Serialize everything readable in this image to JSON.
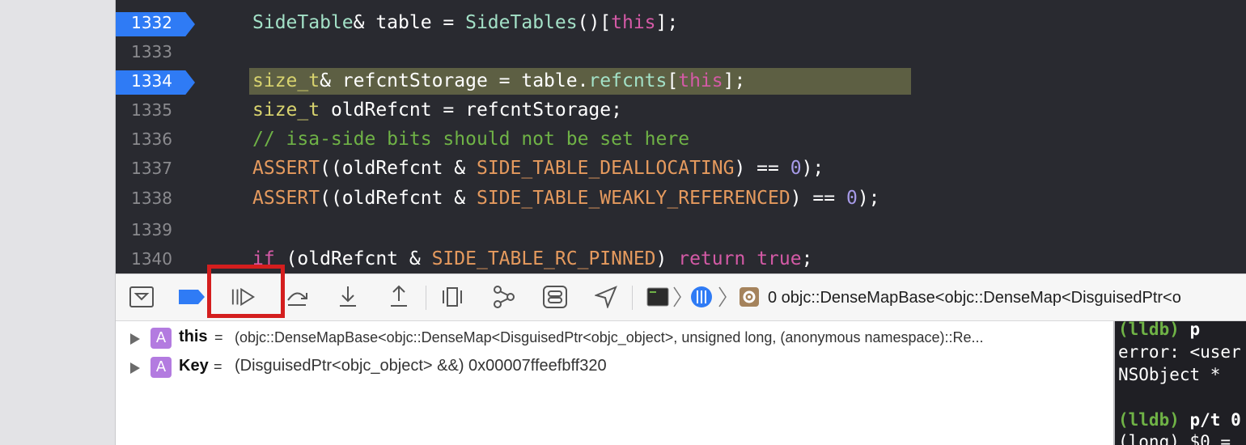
{
  "editor": {
    "lines": [
      {
        "num": "1332",
        "breakpoint": true
      },
      {
        "num": "1333",
        "breakpoint": false
      },
      {
        "num": "1334",
        "breakpoint": true
      },
      {
        "num": "1335",
        "breakpoint": false
      },
      {
        "num": "1336",
        "breakpoint": false
      },
      {
        "num": "1337",
        "breakpoint": false
      },
      {
        "num": "1338",
        "breakpoint": false
      },
      {
        "num": "1339",
        "breakpoint": false
      },
      {
        "num": "1340",
        "breakpoint": false
      }
    ],
    "code": {
      "l1332": {
        "t1": "SideTable",
        "t2": "& table = ",
        "t3": "SideTables",
        "t4": "()[",
        "t5": "this",
        "t6": "];"
      },
      "l1334": {
        "t1": "size_t",
        "t2": "& refcntStorage = table.",
        "t3": "refcnts",
        "t4": "[",
        "t5": "this",
        "t6": "];"
      },
      "l1335": {
        "t1": "size_t",
        "t2": " oldRefcnt = refcntStorage;"
      },
      "l1336": {
        "t1": "// isa-side bits should not be set here"
      },
      "l1337": {
        "t1": "ASSERT",
        "t2": "((oldRefcnt & ",
        "t3": "SIDE_TABLE_DEALLOCATING",
        "t4": ") == ",
        "t5": "0",
        "t6": ");"
      },
      "l1338": {
        "t1": "ASSERT",
        "t2": "((oldRefcnt & ",
        "t3": "SIDE_TABLE_WEAKLY_REFERENCED",
        "t4": ") == ",
        "t5": "0",
        "t6": ");"
      },
      "l1340": {
        "t1": "if",
        "t2": " (oldRefcnt & ",
        "t3": "SIDE_TABLE_RC_PINNED",
        "t4": ") ",
        "t5": "return",
        "t6": " ",
        "t7": "true",
        "t8": ";"
      }
    }
  },
  "toolbar": {
    "breadcrumb_text": "0 objc::DenseMapBase<objc::DenseMap<DisguisedPtr<o"
  },
  "variables": [
    {
      "badge": "A",
      "name": "this",
      "eq": " = ",
      "value": "(objc::DenseMapBase<objc::DenseMap<DisguisedPtr<objc_object>, unsigned long, (anonymous namespace)::Re..."
    },
    {
      "badge": "A",
      "name": "Key",
      "eq": " = ",
      "value": "(DisguisedPtr<objc_object> &&) 0x00007ffeefbff320"
    }
  ],
  "console": {
    "lines": [
      {
        "prompt": "(lldb)",
        "text": " p"
      },
      {
        "text": "error: <user"
      },
      {
        "text": "NSObject *"
      },
      {
        "text": ""
      },
      {
        "prompt": "(lldb)",
        "text": " p/t 0"
      },
      {
        "text": "(long) $0 = "
      }
    ]
  }
}
